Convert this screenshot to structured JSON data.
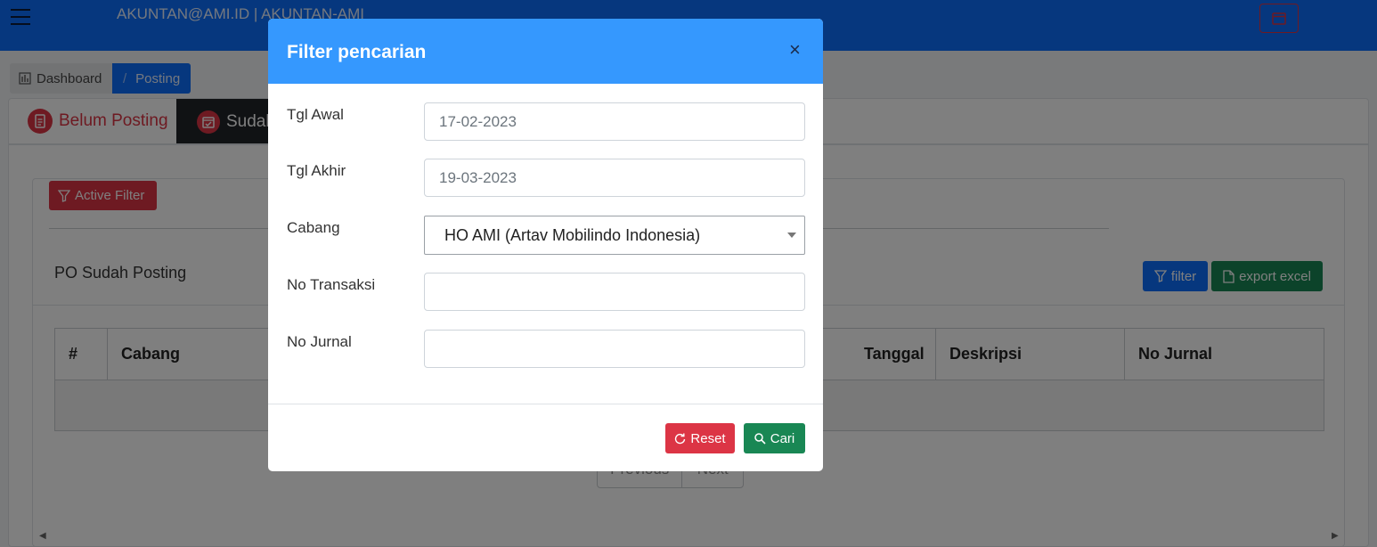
{
  "header": {
    "user_title": "AKUNTAN@AMI.ID | AKUNTAN-AMI"
  },
  "breadcrumb": {
    "dashboard": "Dashboard",
    "separator": "/",
    "posting": "Posting"
  },
  "tabs": [
    {
      "label": "Belum Posting",
      "icon": "document-icon",
      "active": false
    },
    {
      "label": "Sudah",
      "icon": "calendar-check-icon",
      "active": true
    }
  ],
  "content": {
    "active_filter_label": "Active Filter",
    "section_title": "PO Sudah Posting",
    "filter_button": "filter",
    "export_button": "export excel",
    "table": {
      "columns": [
        "#",
        "Cabang",
        "Tanggal",
        "Deskripsi",
        "No Jurnal"
      ],
      "rows": []
    },
    "pager": {
      "previous": "Previous",
      "next": "Next"
    }
  },
  "modal": {
    "title": "Filter pencarian",
    "close_symbol": "×",
    "fields": {
      "tgl_awal": {
        "label": "Tgl Awal",
        "value": "17-02-2023"
      },
      "tgl_akhir": {
        "label": "Tgl Akhir",
        "value": "19-03-2023"
      },
      "cabang": {
        "label": "Cabang",
        "value": "HO AMI (Artav Mobilindo Indonesia)"
      },
      "no_transaksi": {
        "label": "No Transaksi",
        "value": ""
      },
      "no_jurnal": {
        "label": "No Jurnal",
        "value": ""
      }
    },
    "reset_button": "Reset",
    "cari_button": "Cari"
  },
  "colors": {
    "primary": "#0d6efd",
    "modal_header": "#3598fe",
    "danger": "#dc3545",
    "success": "#198754",
    "dark_tab": "#212529"
  }
}
